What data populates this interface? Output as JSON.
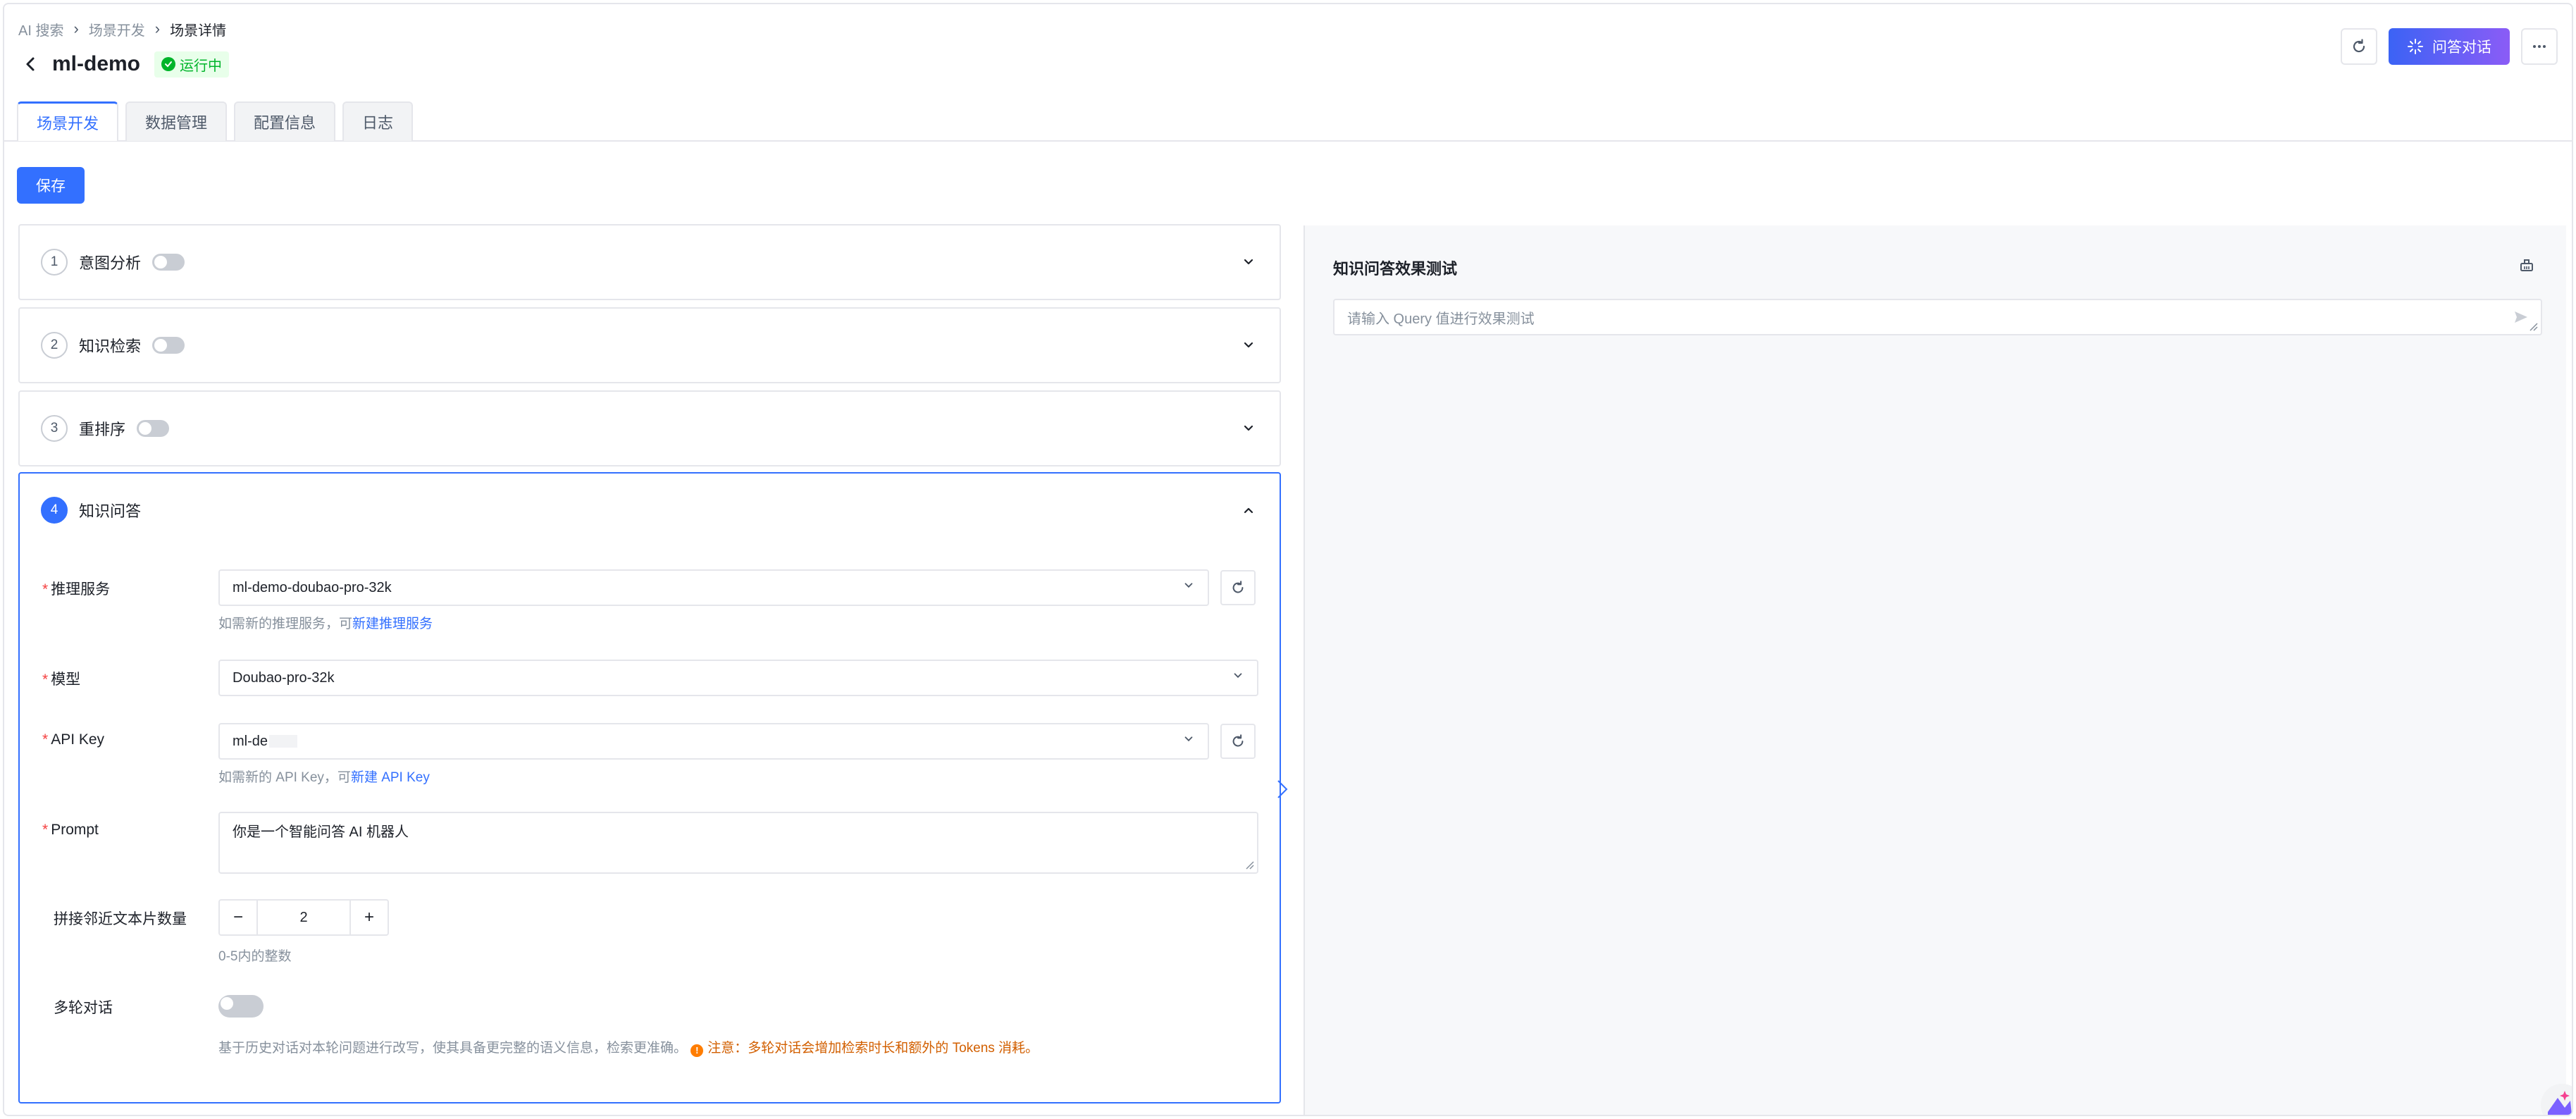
{
  "breadcrumb": [
    "AI 搜索",
    "场景开发",
    "场景详情"
  ],
  "page": {
    "title": "ml-demo",
    "status": "运行中"
  },
  "header": {
    "chat_label": "问答对话",
    "refresh_icon": "refresh-icon",
    "more_icon": "more-icon"
  },
  "tabs": [
    {
      "label": "场景开发",
      "active": true
    },
    {
      "label": "数据管理",
      "active": false
    },
    {
      "label": "配置信息",
      "active": false
    },
    {
      "label": "日志",
      "active": false
    }
  ],
  "save_label": "保存",
  "steps": [
    {
      "num": "1",
      "title": "意图分析",
      "enabled": false
    },
    {
      "num": "2",
      "title": "知识检索",
      "enabled": false
    },
    {
      "num": "3",
      "title": "重排序",
      "enabled": false
    },
    {
      "num": "4",
      "title": "知识问答"
    }
  ],
  "qa_form": {
    "inference_service": {
      "label": "推理服务",
      "value": "ml-demo-doubao-pro-32k",
      "hint": "如需新的推理服务，可",
      "hint_link": "新建推理服务"
    },
    "model": {
      "label": "模型",
      "value": "Doubao-pro-32k"
    },
    "api_key": {
      "label": "API Key",
      "value": "ml-de",
      "hint": "如需新的 API Key，可",
      "hint_link": "新建 API Key"
    },
    "prompt": {
      "label": "Prompt",
      "value": "你是一个智能问答 AI 机器人"
    },
    "adjacent_chunks": {
      "label": "拼接邻近文本片数量",
      "value": "2",
      "minus": "−",
      "plus": "+",
      "hint": "0-5内的整数"
    },
    "multi_turn": {
      "label": "多轮对话",
      "enabled": false,
      "hint": "基于历史对话对本轮问题进行改写，使其具备更完整的语义信息，检索更准确。",
      "warning": "注意：多轮对话会增加检索时长和额外的 Tokens 消耗。"
    }
  },
  "test_panel": {
    "title": "知识问答效果测试",
    "query_placeholder": "请输入 Query 值进行效果测试"
  },
  "colors": {
    "primary": "#3370ff",
    "success": "#00b42a",
    "warning": "#d25f00",
    "required": "#f53f3f"
  }
}
